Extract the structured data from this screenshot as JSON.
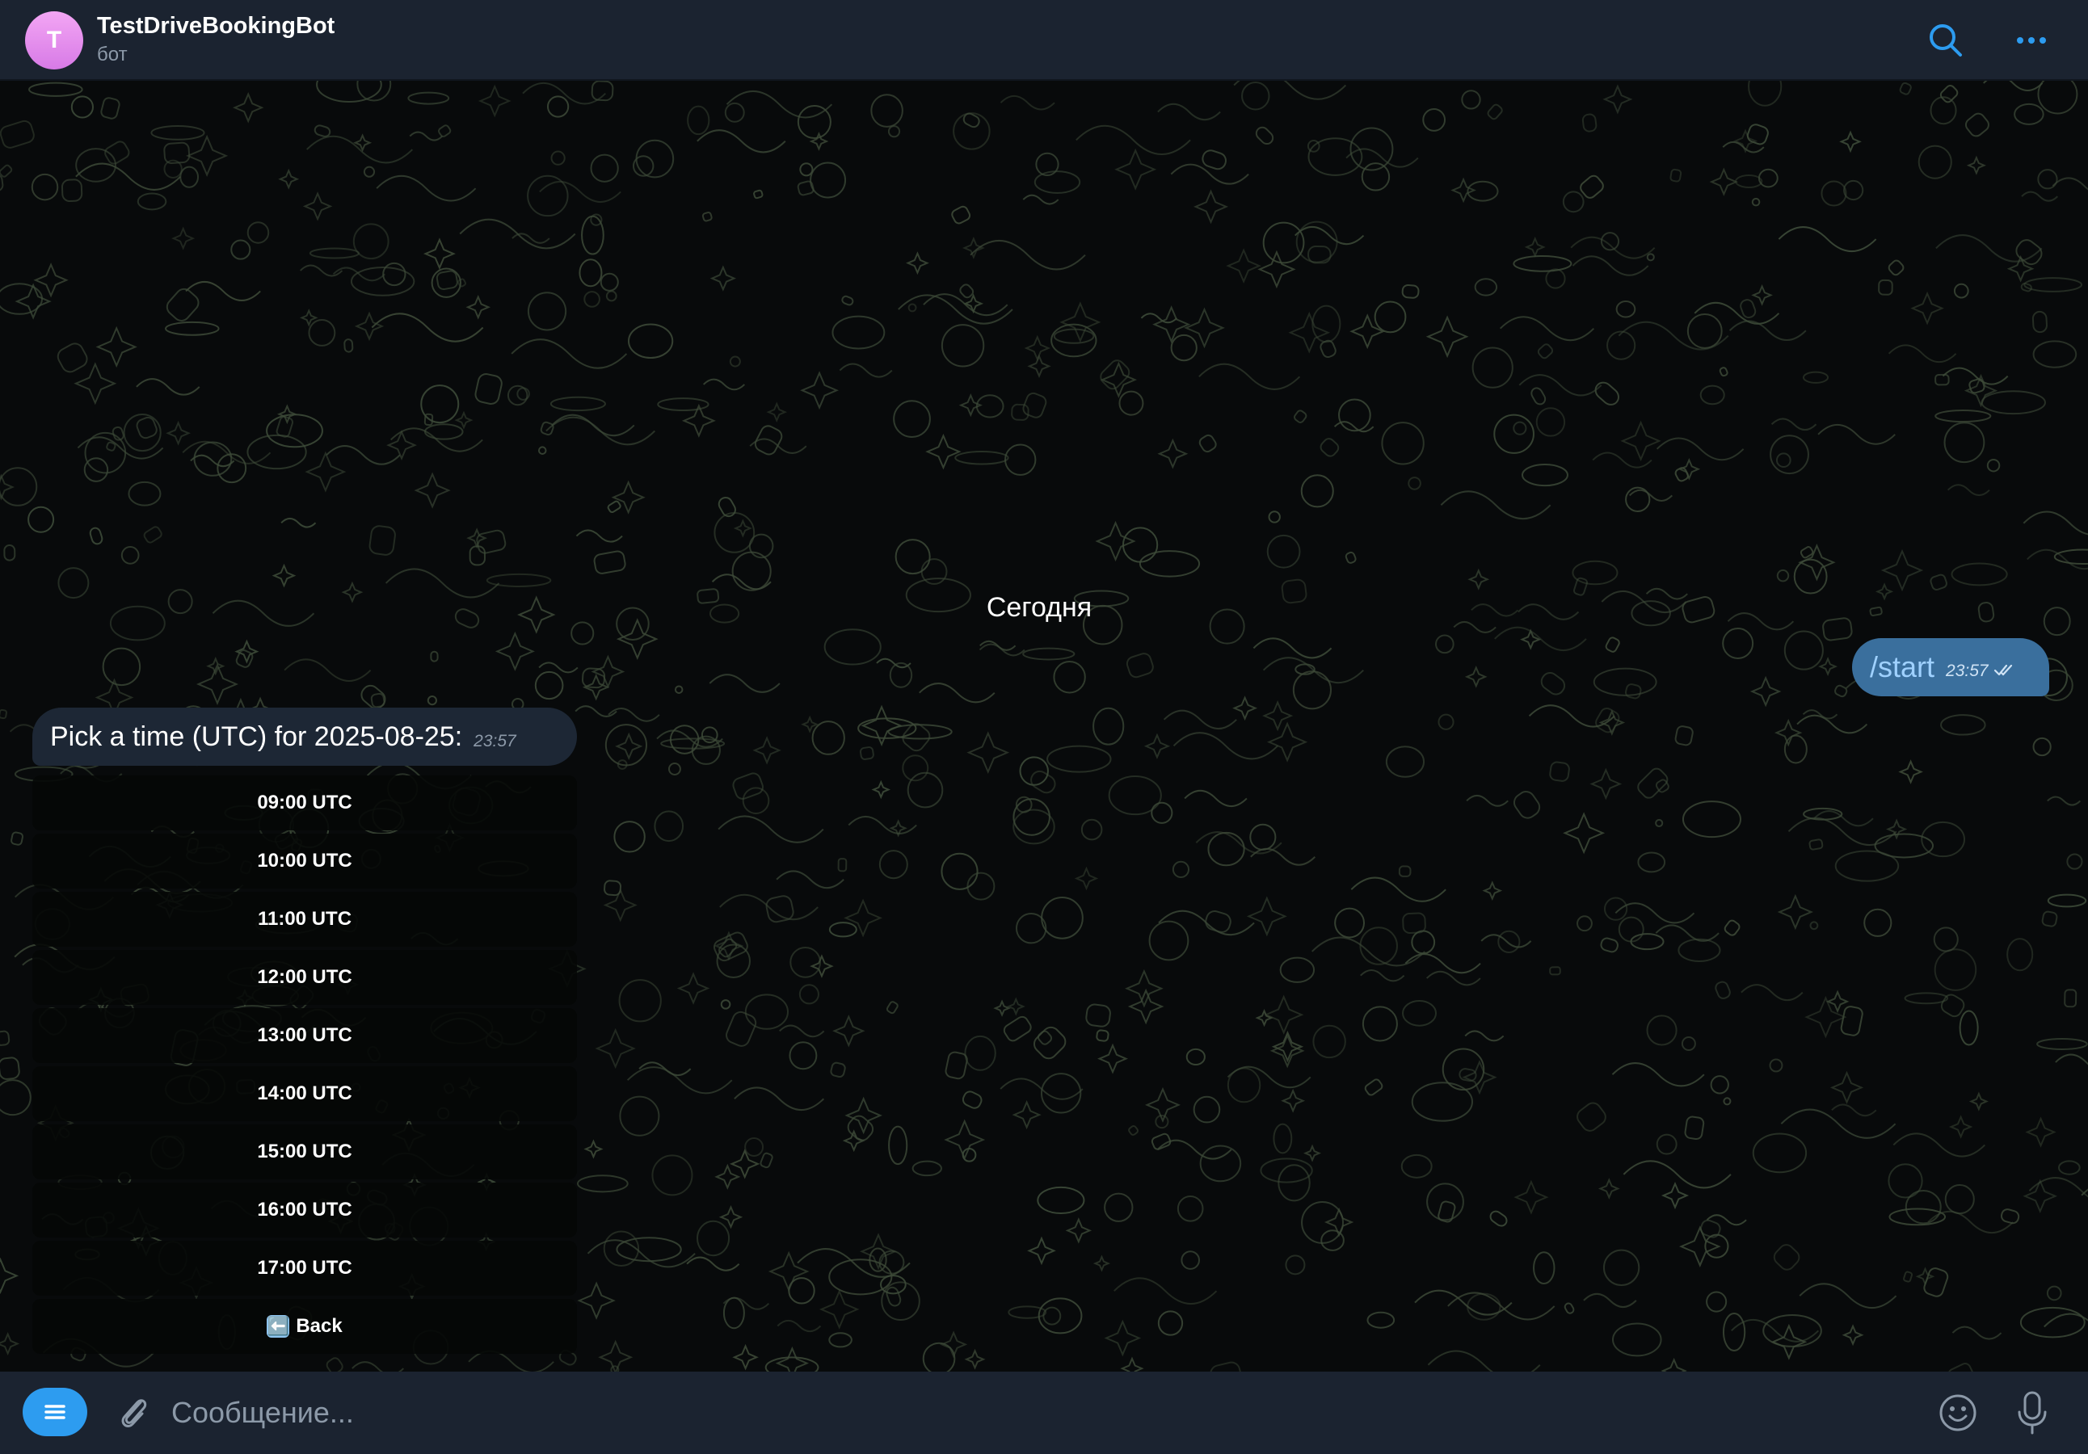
{
  "header": {
    "avatar_letter": "T",
    "title": "TestDriveBookingBot",
    "subtitle": "бот",
    "icons": [
      "search-icon",
      "more-icon"
    ]
  },
  "chat": {
    "date_separator": "Сегодня",
    "outgoing": {
      "text": "/start",
      "time": "23:57",
      "status_icon": "double-check-icon"
    },
    "incoming": {
      "text": "Pick a time (UTC) for 2025-08-25:",
      "time": "23:57"
    },
    "keyboard": [
      "09:00 UTC",
      "10:00 UTC",
      "11:00 UTC",
      "12:00 UTC",
      "13:00 UTC",
      "14:00 UTC",
      "15:00 UTC",
      "16:00 UTC",
      "17:00 UTC"
    ],
    "back_button": {
      "emoji": "⬅️",
      "label": "Back"
    }
  },
  "input": {
    "placeholder": "Сообщение...",
    "value": "",
    "icons": [
      "menu-icon",
      "paperclip-icon",
      "emoji-icon",
      "microphone-icon"
    ]
  },
  "colors": {
    "header_bg": "#1b2330",
    "chat_bg": "#080a0b",
    "accent": "#2d9cf0",
    "outgoing_bubble": "#3a6f9d",
    "incoming_bubble": "#1d2735",
    "wallpaper_doodle": "#3d4a38"
  }
}
